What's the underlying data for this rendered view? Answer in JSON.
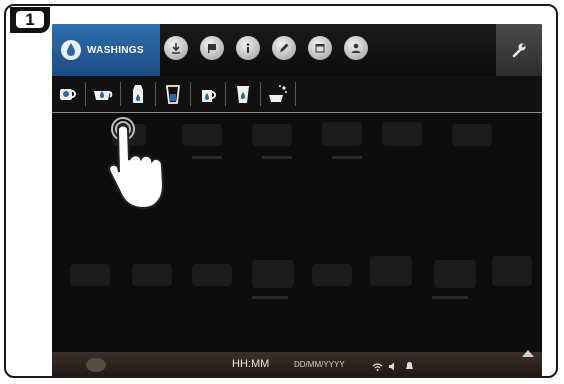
{
  "step": {
    "number": "1"
  },
  "topbar": {
    "active_tab": {
      "label": "WASHINGS",
      "icon": "water-drop-icon"
    },
    "icons": [
      "download-icon",
      "flag-icon",
      "info-icon",
      "pencil-icon",
      "calendar-icon",
      "user-icon"
    ],
    "settings_icon": "wrench-icon"
  },
  "subbar": {
    "icons": [
      "coffee-cup-wash-icon",
      "cup-drop-icon",
      "milk-carton-icon",
      "glass-icon",
      "milk-jug-icon",
      "glass-drop-icon",
      "cleaning-sparkle-icon"
    ]
  },
  "statusbar": {
    "time": "HH:MM",
    "date": "DD/MM/YYYY",
    "icons": [
      "wifi-icon",
      "sound-icon",
      "bell-icon"
    ],
    "expand_icon": "chevron-up-icon"
  },
  "colors": {
    "accent": "#2a66a8",
    "screen_bg": "#0d0d0d"
  }
}
